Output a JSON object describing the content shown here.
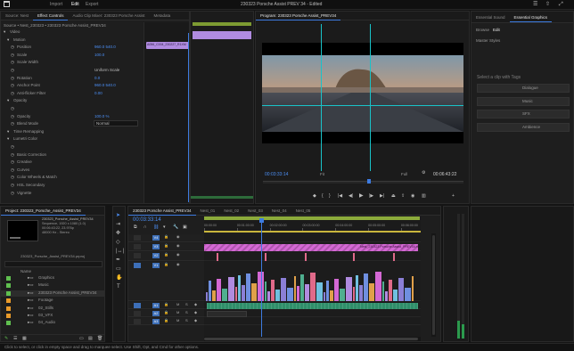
{
  "app": {
    "title": "230323 Porsche Assist PREV 34 - Edited",
    "nav": [
      "Import",
      "Edit",
      "Export"
    ],
    "nav_active": 1
  },
  "source_panel": {
    "tabs": [
      "Source: Nest",
      "Effect Controls",
      "Audio Clip Mixer: 230323 Porsche Assist",
      "Metadata"
    ],
    "header": "Source • Nest_230323 • 230323 Porsche Assist_PREV34",
    "rows": [
      {
        "label": "Video",
        "value": "",
        "indent": 0
      },
      {
        "label": "Motion",
        "value": "",
        "indent": 1
      },
      {
        "label": "Position",
        "value": "960.0  540.0",
        "indent": 2
      },
      {
        "label": "Scale",
        "value": "100.0",
        "indent": 2
      },
      {
        "label": "Scale Width",
        "value": "",
        "indent": 2
      },
      {
        "label": "",
        "value": "Uniform Scale",
        "indent": 2
      },
      {
        "label": "Rotation",
        "value": "0.0",
        "indent": 2
      },
      {
        "label": "Anchor Point",
        "value": "960.0  540.0",
        "indent": 2
      },
      {
        "label": "Anti-flicker Filter",
        "value": "0.00",
        "indent": 2
      },
      {
        "label": "Opacity",
        "value": "",
        "indent": 1
      },
      {
        "label": "",
        "value": "",
        "indent": 2
      },
      {
        "label": "Opacity",
        "value": "100.0 %",
        "indent": 2
      },
      {
        "label": "Blend Mode",
        "value": "Normal",
        "indent": 2
      },
      {
        "label": "Time Remapping",
        "value": "",
        "indent": 1
      },
      {
        "label": "Lumetri Color",
        "value": "",
        "indent": 1
      },
      {
        "label": "",
        "value": "",
        "indent": 2
      },
      {
        "label": "Basic Correction",
        "value": "",
        "indent": 2
      },
      {
        "label": "Creative",
        "value": "",
        "indent": 2
      },
      {
        "label": "Curves",
        "value": "",
        "indent": 2
      },
      {
        "label": "Color Wheels & Match",
        "value": "",
        "indent": 2
      },
      {
        "label": "HSL Secondary",
        "value": "",
        "indent": 2
      },
      {
        "label": "Vignette",
        "value": "",
        "indent": 2
      }
    ],
    "mini_timeline_clip": "A056_C004_230227_R1XM"
  },
  "program_monitor": {
    "tab": "Program: 230323 Porsche Assist_PREV34",
    "timecode_left": "00:03:33:14",
    "timecode_right": "00:06:43:22",
    "fit": "Fit",
    "quality": "Full"
  },
  "essential_graphics": {
    "tabs": [
      "Essential Sound",
      "Essential Graphics"
    ],
    "subtabs": [
      "Browse",
      "Edit"
    ],
    "subtab_active": 1,
    "label": "Master Styles",
    "hint": "Select a clip with Tags",
    "buttons": [
      "Dialogue",
      "Music",
      "SFX",
      "Ambience"
    ]
  },
  "project_panel": {
    "tab": "Project: 230323_Porsche_Assist_PREV34",
    "preview_info": [
      "230323_Porsche_Assist_PREV34",
      "Sequence, 1920 x 1080 (1.0)",
      "00:06:43:22, 23.976p",
      "48000 Hz - Stereo"
    ],
    "path": "230323_Porsche_Assist_PREV34.prproj",
    "column": "Name",
    "items": [
      {
        "name": "Graphics",
        "color": "#5fbf4f"
      },
      {
        "name": "Music",
        "color": "#5fbf4f"
      },
      {
        "name": "230323 Porsche Assist_PREV34",
        "color": "#5fbf4f"
      },
      {
        "name": "Footage",
        "color": "#e89a2a"
      },
      {
        "name": "02_Stills",
        "color": "#e89a2a"
      },
      {
        "name": "03_VFX",
        "color": "#e89a2a"
      },
      {
        "name": "04_Audio",
        "color": "#5fbf4f"
      }
    ]
  },
  "timeline": {
    "tabs": [
      "230323 Porsche Assist_PREV34",
      "Nest_01",
      "Nest_02",
      "Nest_03",
      "Nest_04",
      "Nest_05"
    ],
    "timecode": "00:03:33:14",
    "ruler": [
      "00:00:00",
      "00:01:00:00",
      "00:02:00:00",
      "00:03:00:00",
      "00:04:00:00",
      "00:05:00:00",
      "00:06:00:00"
    ],
    "video_tracks": [
      "V4",
      "V3",
      "V2",
      "V1"
    ],
    "audio_tracks": [
      "A1",
      "A2",
      "A3"
    ],
    "graphic_clip": "Nest_230323 Porsche Assist_PREV34.mov"
  },
  "status_bar": "Click to select, or click in empty space and drag to marquee select. Use Shift, Opt, and Cmd for other options.",
  "colors": {
    "accent": "#3d7be0",
    "video_clip": "#8b7fd6",
    "graphic_clip": "#d468d4",
    "audio_clip": "#2f8f6a",
    "tc_blue": "#4c8ff5",
    "guide": "#19c3c9",
    "work_area": "#8cab3b"
  }
}
